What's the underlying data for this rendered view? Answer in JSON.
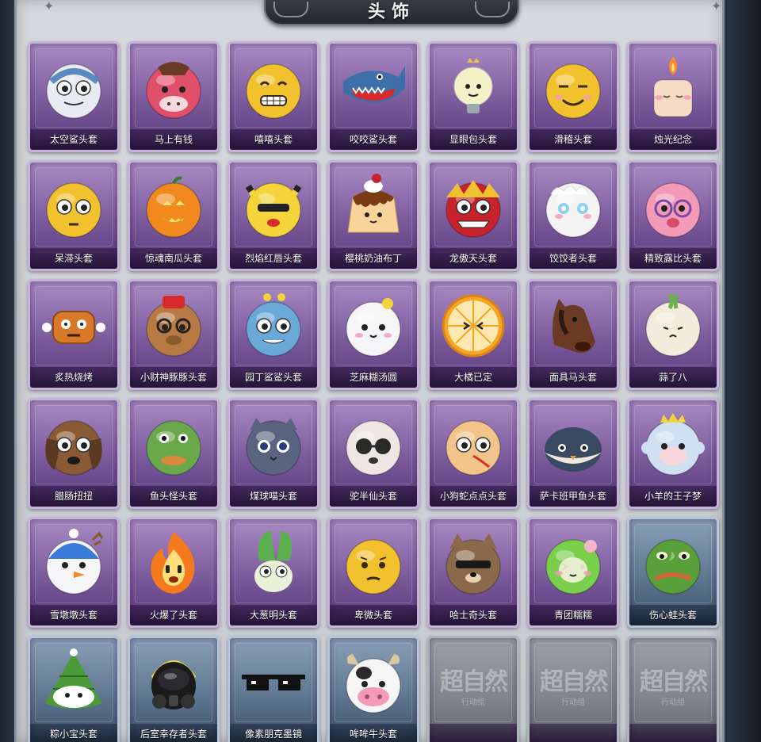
{
  "header": {
    "title": "头饰"
  },
  "colors": {
    "rare": "#7b5a9c",
    "uncommon": "#5f7690",
    "locked": "#7c838b"
  },
  "items": [
    {
      "label": "太空鲨头套",
      "icon": "shark-egg-icon",
      "base": "#e8ecf2",
      "accent": "#5b8ac0",
      "tier": "purple"
    },
    {
      "label": "马上有钱",
      "icon": "pink-horse-icon",
      "base": "#e0506a",
      "accent": "#f7d6dc",
      "tier": "purple"
    },
    {
      "label": "嘻嘻头套",
      "icon": "grin-emoji-icon",
      "base": "#f2c12e",
      "accent": "#3a2a10",
      "tier": "purple"
    },
    {
      "label": "咬咬鲨头套",
      "icon": "biting-shark-icon",
      "base": "#3e6fa8",
      "accent": "#ffffff",
      "tier": "purple"
    },
    {
      "label": "显眼包头套",
      "icon": "lightbulb-icon",
      "base": "#f4f1c9",
      "accent": "#e8c44a",
      "tier": "purple"
    },
    {
      "label": "滑稽头套",
      "icon": "funny-face-icon",
      "base": "#f2c12e",
      "accent": "#e88a8a",
      "tier": "purple"
    },
    {
      "label": "烛光纪念",
      "icon": "candle-icon",
      "base": "#f6dcc4",
      "accent": "#ff8a2a",
      "tier": "purple"
    },
    {
      "label": "呆滞头套",
      "icon": "blank-stare-icon",
      "base": "#f2c12e",
      "accent": "#ffffff",
      "tier": "purple"
    },
    {
      "label": "惊魂南瓜头套",
      "icon": "pumpkin-icon",
      "base": "#f08a1e",
      "accent": "#ffe07a",
      "tier": "purple"
    },
    {
      "label": "烈焰红唇头套",
      "icon": "pikachu-hood-icon",
      "base": "#f5d33a",
      "accent": "#d82a2a",
      "tier": "purple"
    },
    {
      "label": "樱桃奶油布丁",
      "icon": "pudding-icon",
      "base": "#f8d49a",
      "accent": "#c8232c",
      "tier": "purple"
    },
    {
      "label": "龙傲天头套",
      "icon": "dragon-icon",
      "base": "#c8232c",
      "accent": "#f2c12e",
      "tier": "purple"
    },
    {
      "label": "饺饺者头套",
      "icon": "dumpling-icon",
      "base": "#f4f4f4",
      "accent": "#8fd0f0",
      "tier": "purple"
    },
    {
      "label": "精致露比头套",
      "icon": "beaver-icon",
      "base": "#f29ab8",
      "accent": "#7a4aa0",
      "tier": "purple"
    },
    {
      "label": "炙热烧烤",
      "icon": "grilled-meat-icon",
      "base": "#d87a2a",
      "accent": "#ffffff",
      "tier": "purple"
    },
    {
      "label": "小财神豚豚头套",
      "icon": "capybara-icon",
      "base": "#b77a44",
      "accent": "#d82a2a",
      "tier": "purple"
    },
    {
      "label": "园丁鲨鲨头套",
      "icon": "gardener-shark-icon",
      "base": "#6aa8d8",
      "accent": "#f5d33a",
      "tier": "purple"
    },
    {
      "label": "芝麻糊汤圆",
      "icon": "rice-ball-icon",
      "base": "#f6f6f8",
      "accent": "#f5d33a",
      "tier": "purple"
    },
    {
      "label": "大橘已定",
      "icon": "orange-slice-icon",
      "base": "#f5a623",
      "accent": "#ffe9b0",
      "tier": "purple"
    },
    {
      "label": "面具马头套",
      "icon": "horse-mask-icon",
      "base": "#6a3a24",
      "accent": "#2a1a12",
      "tier": "purple"
    },
    {
      "label": "蒜了八",
      "icon": "garlic-icon",
      "base": "#f3ecdc",
      "accent": "#6ab04c",
      "tier": "purple"
    },
    {
      "label": "腊肠扭扭",
      "icon": "dachshund-icon",
      "base": "#8a5a34",
      "accent": "#5a3a20",
      "tier": "purple"
    },
    {
      "label": "鱼头怪头套",
      "icon": "fish-head-icon",
      "base": "#6aa84c",
      "accent": "#d88a3a",
      "tier": "purple"
    },
    {
      "label": "煤球喵头套",
      "icon": "gray-cat-icon",
      "base": "#5a6480",
      "accent": "#f5d33a",
      "tier": "purple"
    },
    {
      "label": "驼半仙头套",
      "icon": "alpaca-glasses-icon",
      "base": "#efe6e4",
      "accent": "#2a2a2a",
      "tier": "purple"
    },
    {
      "label": "小狗蛇点点头套",
      "icon": "snake-dog-icon",
      "base": "#f2c48a",
      "accent": "#d82a2a",
      "tier": "purple"
    },
    {
      "label": "萨卡班甲鱼头套",
      "icon": "fish-icon",
      "base": "#3a4a62",
      "accent": "#efe6dc",
      "tier": "purple"
    },
    {
      "label": "小羊的王子梦",
      "icon": "sheep-crown-icon",
      "base": "#cfe0f2",
      "accent": "#f5d33a",
      "tier": "purple"
    },
    {
      "label": "雪墩墩头套",
      "icon": "snowman-icon",
      "base": "#f6f6f8",
      "accent": "#3a7ad8",
      "tier": "purple"
    },
    {
      "label": "火爆了头套",
      "icon": "flame-icon",
      "base": "#f57a1e",
      "accent": "#ffe07a",
      "tier": "purple"
    },
    {
      "label": "大葱明头套",
      "icon": "green-onion-icon",
      "base": "#e8f2d8",
      "accent": "#5ab04c",
      "tier": "purple"
    },
    {
      "label": "卑微头套",
      "icon": "sad-emoji-icon",
      "base": "#f2c12e",
      "accent": "#3a2a10",
      "tier": "purple"
    },
    {
      "label": "哈士奇头套",
      "icon": "husky-icon",
      "base": "#8a6a4a",
      "accent": "#1a1a1a",
      "tier": "purple"
    },
    {
      "label": "青团糯糯",
      "icon": "green-dumpling-icon",
      "base": "#7ad04c",
      "accent": "#f7b6c8",
      "tier": "purple"
    },
    {
      "label": "伤心蛙头套",
      "icon": "sad-frog-icon",
      "base": "#5aa03a",
      "accent": "#c86a3a",
      "tier": "blue"
    },
    {
      "label": "粽小宝头套",
      "icon": "zongzi-icon",
      "base": "#4a9a3a",
      "accent": "#ffffff",
      "tier": "blue"
    },
    {
      "label": "后室幸存者头套",
      "icon": "gas-mask-icon",
      "base": "#1a1a1a",
      "accent": "#f5d33a",
      "tier": "blue"
    },
    {
      "label": "像素朋克墨镜",
      "icon": "pixel-sunglasses-icon",
      "base": "#111111",
      "accent": "#ffffff",
      "tier": "blue"
    },
    {
      "label": "哞哞牛头套",
      "icon": "cow-icon",
      "base": "#f6f6f6",
      "accent": "#f29ab8",
      "tier": "blue"
    },
    {
      "label": "",
      "icon": "locked-slot-icon",
      "tier": "locked",
      "mark": "超自然",
      "sub": "行动组"
    },
    {
      "label": "",
      "icon": "locked-slot-icon",
      "tier": "locked",
      "mark": "超自然",
      "sub": "行动组"
    },
    {
      "label": "",
      "icon": "locked-slot-icon",
      "tier": "locked",
      "mark": "超自然",
      "sub": "行动组"
    }
  ]
}
